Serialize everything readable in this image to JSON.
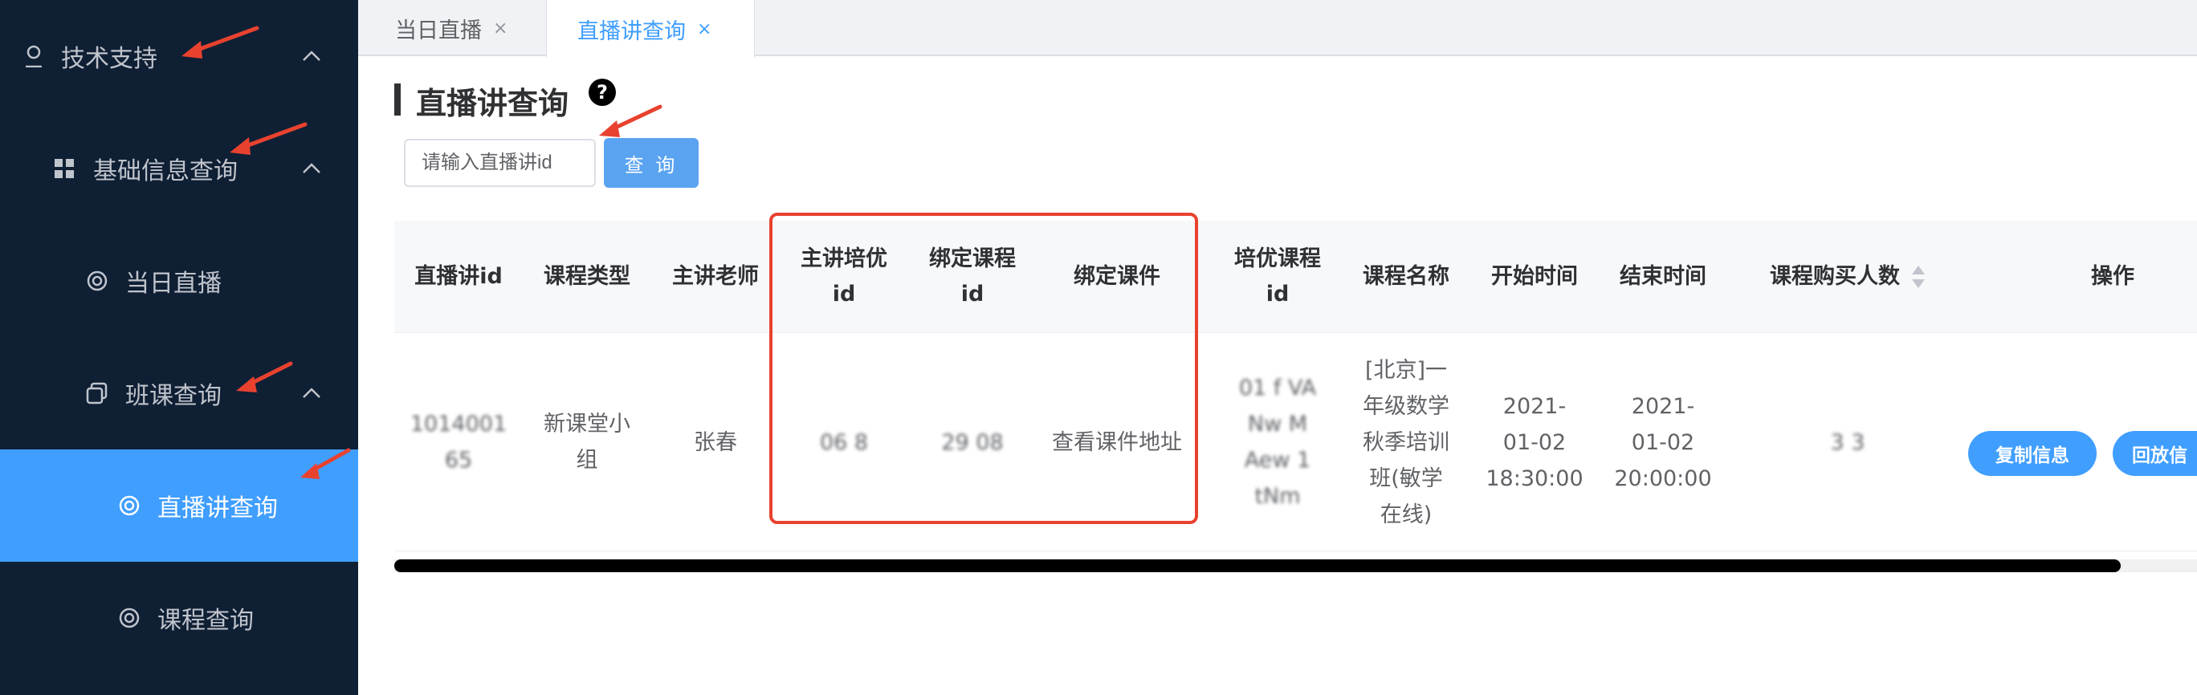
{
  "sidebar": {
    "items": [
      {
        "label": "技术支持"
      },
      {
        "label": "基础信息查询"
      },
      {
        "label": "当日直播"
      },
      {
        "label": "班课查询"
      },
      {
        "label": "直播讲查询"
      },
      {
        "label": "课程查询"
      }
    ]
  },
  "tabs": [
    {
      "label": "当日直播",
      "close": "×"
    },
    {
      "label": "直播讲查询",
      "close": "×"
    }
  ],
  "page": {
    "title": "直播讲查询",
    "help": "?"
  },
  "search": {
    "placeholder": "请输入直播讲id",
    "button": "查 询"
  },
  "table": {
    "headers": [
      "直播讲id",
      "课程类型",
      "主讲老师",
      "主讲培优id",
      "绑定课程id",
      "绑定课件",
      "培优课程id",
      "课程名称",
      "开始时间",
      "结束时间",
      "课程购买人数",
      "操作"
    ],
    "row": {
      "live_id": "1014001 65",
      "course_type": "新课堂小组",
      "teacher": "张春",
      "main_peiyou_id": "06  8",
      "bound_course_id": "29  08",
      "bound_courseware": "查看课件地址",
      "peiyou_course_id": "01  f VA  Nw M  Aew 1  tNm",
      "course_name": "[北京]一年级数学秋季培训班(敏学在线)",
      "start_time": "2021-01-02 18:30:00",
      "end_time": "2021-01-02 20:00:00",
      "buyers": "3  3",
      "actions": [
        "复制信息",
        "回放信"
      ]
    }
  },
  "colors": {
    "sidebar_bg": "#0f1f34",
    "active": "#409eff",
    "highlight": "#e8422f"
  }
}
